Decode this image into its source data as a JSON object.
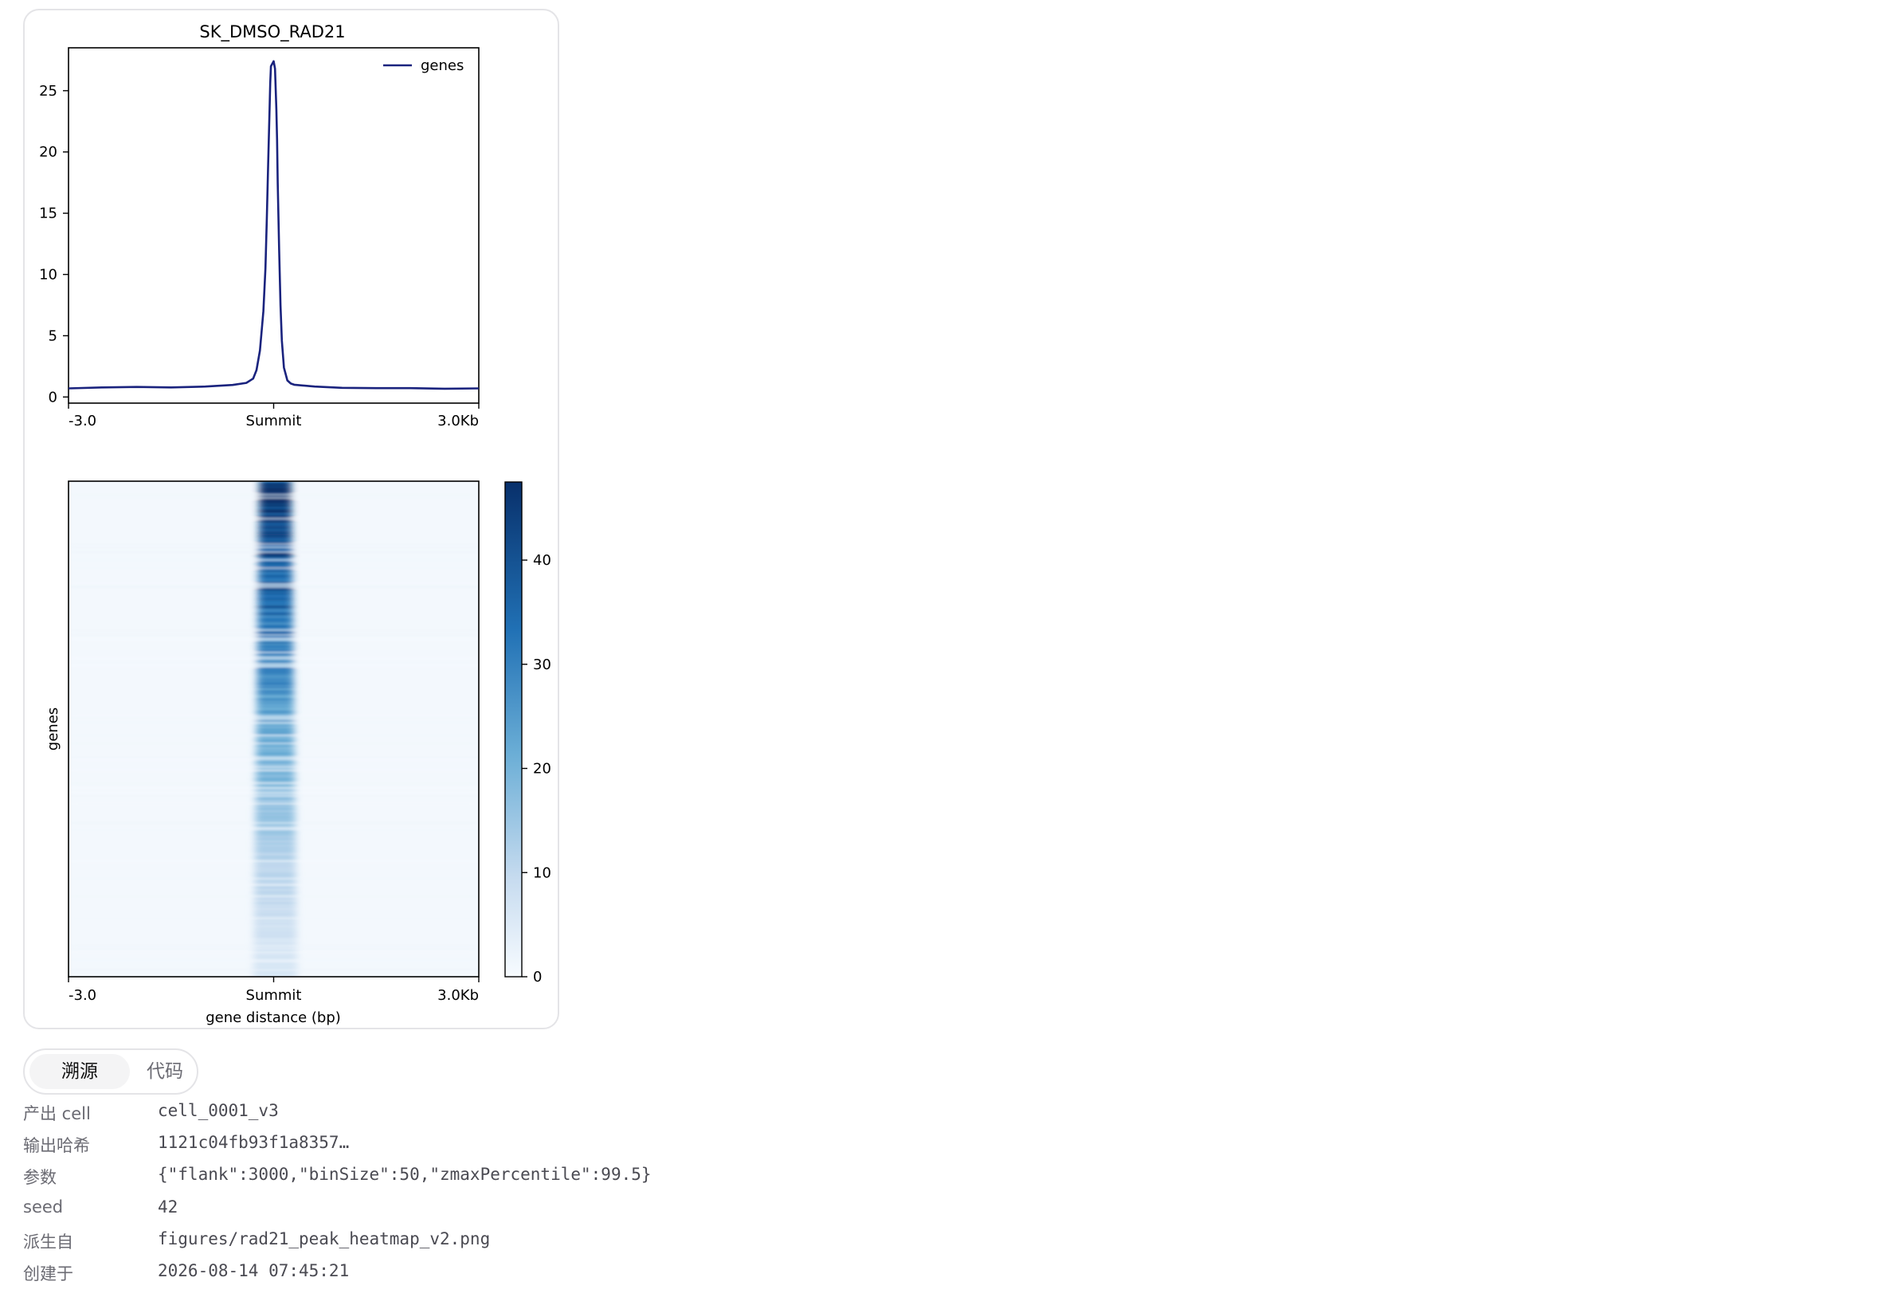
{
  "chart_data": {
    "type": "line",
    "title": "SK_DMSO_RAD21",
    "profile": {
      "legend": "genes",
      "x_ticks": [
        "-3.0",
        "Summit",
        "3.0Kb"
      ],
      "y_ticks": [
        "0",
        "5",
        "10",
        "15",
        "20",
        "25"
      ],
      "ylim": [
        -0.5,
        28.5
      ],
      "xlim": [
        -3000,
        3000
      ],
      "color": "#1a237e",
      "x": [
        -3000,
        -2500,
        -2000,
        -1500,
        -1000,
        -600,
        -400,
        -300,
        -250,
        -200,
        -150,
        -120,
        -100,
        -80,
        -60,
        -50,
        -40,
        -20,
        0,
        20,
        40,
        50,
        60,
        80,
        100,
        120,
        150,
        200,
        250,
        300,
        400,
        600,
        1000,
        1500,
        2000,
        2500,
        3000
      ],
      "y": [
        0.7,
        0.78,
        0.82,
        0.78,
        0.85,
        0.98,
        1.15,
        1.5,
        2.2,
        3.8,
        7.0,
        10.5,
        14.5,
        19.0,
        23.5,
        25.6,
        27.0,
        27.2,
        27.4,
        26.8,
        23.5,
        21.0,
        17.5,
        12.0,
        7.5,
        4.6,
        2.4,
        1.35,
        1.1,
        1.0,
        0.95,
        0.85,
        0.75,
        0.72,
        0.72,
        0.68,
        0.7
      ]
    },
    "heatmap": {
      "ylabel": "genes",
      "xlabel": "gene distance (bp)",
      "x_ticks": [
        "-3.0",
        "Summit",
        "3.0Kb"
      ],
      "colorbar_ticks": [
        0,
        10,
        20,
        30,
        40
      ],
      "zmax": 47.5,
      "colormap": "Blues",
      "peak_intensity_top": 47,
      "peak_intensity_bottom": 6,
      "background_intensity": 1
    }
  },
  "tabs": {
    "provenance": "溯源",
    "code": "代码"
  },
  "meta": [
    {
      "key": "产出 cell",
      "value": "cell_0001_v3"
    },
    {
      "key": "输出哈希",
      "value": "1121c04fb93f1a8357…"
    },
    {
      "key": "参数",
      "value": "{\"flank\":3000,\"binSize\":50,\"zmaxPercentile\":99.5}"
    },
    {
      "key": "seed",
      "value": "42"
    },
    {
      "key": "派生自",
      "value": "figures/rad21_peak_heatmap_v2.png"
    },
    {
      "key": "创建于",
      "value": "2026-08-14 07:45:21"
    }
  ]
}
